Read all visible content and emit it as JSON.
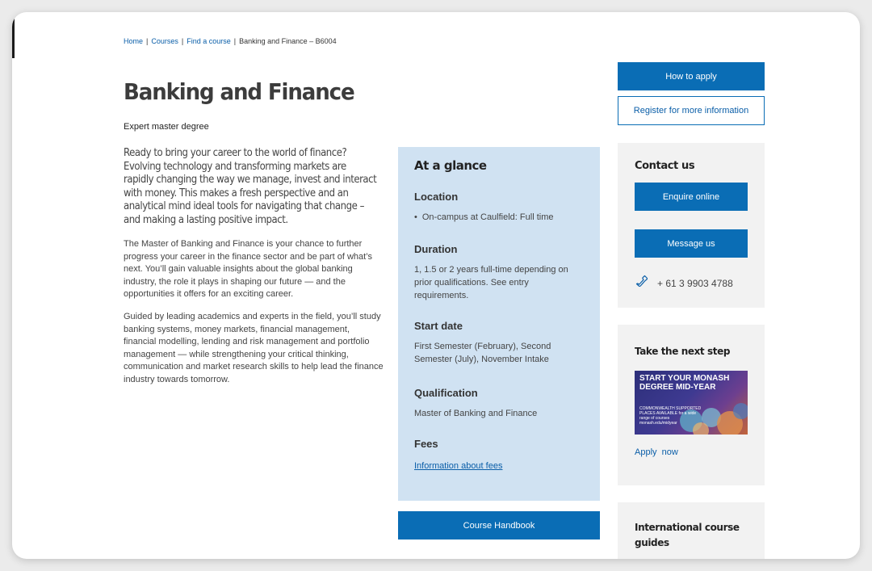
{
  "breadcrumb": {
    "items": [
      "Home",
      "Courses",
      "Find a course"
    ],
    "current": "Banking and Finance – B6004"
  },
  "course": {
    "title": "Banking and Finance",
    "subtitle": "Expert master degree",
    "intro": "Ready to bring your career to the world of finance? Evolving technology and transforming markets are rapidly changing the way we manage, invest and interact with money. This makes a fresh perspective and an analytical mind ideal tools for navigating that change – and making a lasting positive impact.",
    "paragraphs": [
      "The Master of Banking and Finance is your chance to further progress your career in the finance sector and be part of what’s next. You’ll gain valuable insights about the global banking industry, the role it plays in shaping our future — and the opportunities it offers for an exciting career.",
      "Guided by leading academics and experts in the field, you’ll study banking systems, money markets, financial management, financial modelling, lending and risk management and portfolio management — while strengthening your critical thinking, communication and market research skills to help lead the finance industry towards tomorrow."
    ]
  },
  "glance": {
    "heading": "At a glance",
    "location_heading": "Location",
    "location_item": "On-campus at Caulfield: Full time",
    "duration_heading": "Duration",
    "duration_text": "1, 1.5 or 2 years full-time depending on prior qualifications. See entry requirements.",
    "start_heading": "Start date",
    "start_text": "First Semester (February), Second Semester (July), November Intake",
    "qualification_heading": "Qualification",
    "qualification_text": "Master of Banking and Finance",
    "fees_heading": "Fees",
    "fees_link": "Information about fees"
  },
  "buttons": {
    "handbook": "Course Handbook",
    "how_to_apply": "How to apply",
    "register": "Register for more information"
  },
  "contact": {
    "heading": "Contact us",
    "enquire": "Enquire online",
    "message": "Message us",
    "phone": "+ 61 3 9903 4788"
  },
  "next_step": {
    "heading": "Take the next step",
    "promo_title": "START YOUR MONASH DEGREE MID-YEAR",
    "promo_sub": "COMMONWEALTH SUPPORTED PLACES AVAILABLE for a wide range of courses monash.edu/midyear",
    "apply": "Apply  now"
  },
  "intl": {
    "heading": "International course guides"
  },
  "colors": {
    "primary": "#0a6db5",
    "glance_bg": "#d0e2f2",
    "card_bg": "#f2f2f2"
  }
}
